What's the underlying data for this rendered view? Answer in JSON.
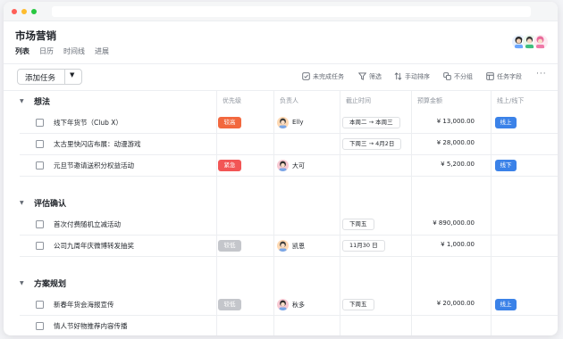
{
  "page": {
    "title": "市场营销",
    "tabs": [
      "列表",
      "日历",
      "时间线",
      "进展"
    ]
  },
  "toolbar": {
    "add_task": "添加任务",
    "items": [
      {
        "label": "未完成任务",
        "icon": "check-square-icon"
      },
      {
        "label": "筛选",
        "icon": "filter-icon"
      },
      {
        "label": "手动排序",
        "icon": "sort-icon"
      },
      {
        "label": "不分组",
        "icon": "group-icon"
      },
      {
        "label": "任务字段",
        "icon": "fields-icon"
      }
    ],
    "more": "···"
  },
  "columns": [
    "优先级",
    "负责人",
    "截止时间",
    "预算金额",
    "线上/线下"
  ],
  "colors": {
    "priority_high": "#f2683e",
    "priority_urgent": "#f25555",
    "priority_low": "#c4c6cb",
    "status": "#3b82e8"
  },
  "groups": [
    {
      "name": "想法",
      "tasks": [
        {
          "title": "线下年货节（Club X）",
          "priority": "较高",
          "priority_level": "high",
          "owner": "Elly",
          "due": "本周二 → 本周三",
          "budget": "¥ 13,000.00",
          "status": "线上"
        },
        {
          "title": "太古里快闪店布展：动漫游戏",
          "priority": "",
          "priority_level": "",
          "owner": "",
          "due": "下周三 → 4月2日",
          "budget": "¥ 28,000.00",
          "status": ""
        },
        {
          "title": "元旦节邀请送积分权益活动",
          "priority": "紧急",
          "priority_level": "urgent",
          "owner": "大可",
          "due": "",
          "budget": "¥ 5,200.00",
          "status": "线下"
        }
      ]
    },
    {
      "name": "评估确认",
      "tasks": [
        {
          "title": "首次付费随机立减活动",
          "priority": "",
          "priority_level": "",
          "owner": "",
          "due": "下周五",
          "budget": "¥ 890,000.00",
          "status": ""
        },
        {
          "title": "公司九周年庆微博转发抽奖",
          "priority": "较低",
          "priority_level": "low",
          "owner": "凯恩",
          "due": "11月30 日",
          "budget": "¥ 1,000.00",
          "status": ""
        }
      ]
    },
    {
      "name": "方案规划",
      "tasks": [
        {
          "title": "新春年货会海报宣传",
          "priority": "较低",
          "priority_level": "low",
          "owner": "秋多",
          "due": "下周五",
          "budget": "¥ 20,000.00",
          "status": "线上"
        },
        {
          "title": "情人节好物推荐内容传播",
          "priority": "",
          "priority_level": "",
          "owner": "",
          "due": "",
          "budget": "",
          "status": ""
        }
      ]
    }
  ]
}
